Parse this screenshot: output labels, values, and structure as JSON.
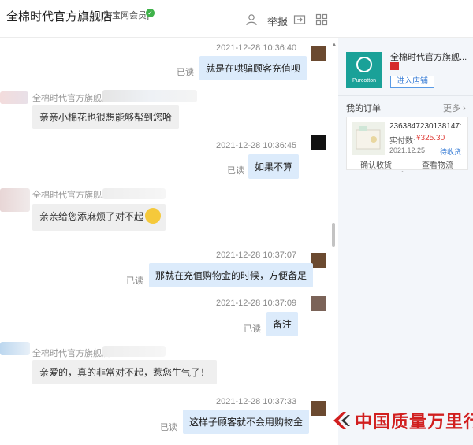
{
  "header": {
    "shop_title": "全棉时代官方旗舰店",
    "member_tag": "[淘宝网会员]",
    "report_label": "举报"
  },
  "chat": {
    "messages": [
      {
        "side": "out",
        "time": "2021-12-28 10:36:40",
        "text": "就是在哄骗顾客充值呗",
        "read": "已读"
      },
      {
        "side": "in",
        "sender": "全棉时代官方旗舰店",
        "text": "亲亲小棉花也很想能够帮到您哈"
      },
      {
        "side": "out",
        "time": "2021-12-28 10:36:45",
        "text": "如果不算",
        "read": "已读"
      },
      {
        "side": "in",
        "sender": "全棉时代官方旗舰店",
        "text": "亲亲给您添麻烦了对不起"
      },
      {
        "side": "out",
        "time": "2021-12-28 10:37:07",
        "text": "那就在充值购物金的时候，方便备足",
        "read": "已读"
      },
      {
        "side": "out",
        "time": "2021-12-28 10:37:09",
        "text": "备注",
        "read": "已读"
      },
      {
        "side": "in",
        "sender": "全棉时代官方旗舰店",
        "text": "亲爱的，真的非常对不起，惹您生气了！"
      },
      {
        "side": "out",
        "time": "2021-12-28 10:37:33",
        "text": "这样子顾客就不会用购物金",
        "read": "已读"
      }
    ]
  },
  "panel": {
    "shop_name": "全棉时代官方旗舰...",
    "logo_text": "Purcotton",
    "enter_button": "进入店铺",
    "orders_title": "我的订单",
    "orders_more": "更多",
    "order": {
      "number": "2363847230138147:",
      "paid_label": "实付数:",
      "paid_value": "¥325.30",
      "date": "2021.12.25",
      "status": "待收货"
    },
    "actions": [
      "确认收货",
      "查看物流"
    ]
  },
  "watermark": {
    "text": "中国质量万里行"
  },
  "colors": {
    "bubble_out": "#dcebfb",
    "bubble_in": "#efefef",
    "price_red": "#e0413c",
    "link_blue": "#3a7ed6",
    "watermark_red": "#d11f1f",
    "logo_teal": "#1aa198"
  }
}
